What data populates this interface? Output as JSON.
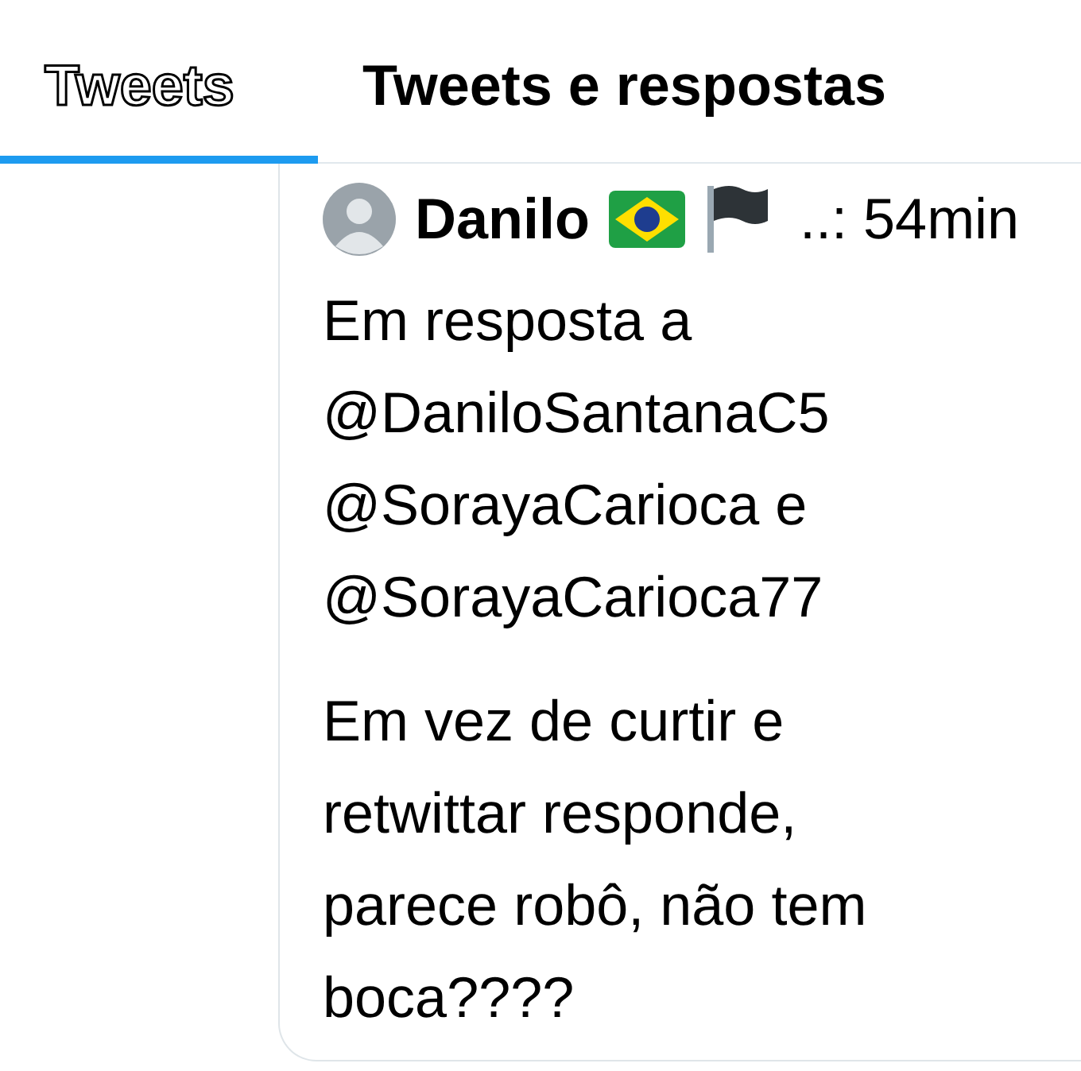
{
  "tabs": [
    {
      "label": "Tweets",
      "selected": true
    },
    {
      "label": "Tweets e respostas",
      "selected": false
    }
  ],
  "tweet": {
    "author": "Danilo",
    "meta": "..: 54min",
    "reply_to": "Em resposta a @DaniloSantanaC5 @SorayaCarioca e @SorayaCarioca77",
    "text": "Em vez de curtir e retwittar responde, parece robô, não tem boca????"
  }
}
